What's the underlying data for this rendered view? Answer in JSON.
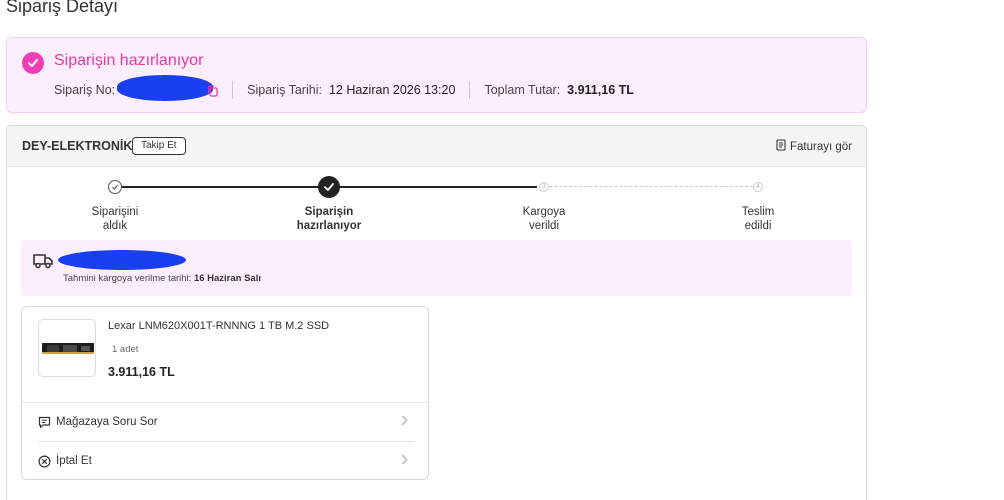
{
  "page": {
    "title": "Sipariş Detayı"
  },
  "status": {
    "title": "Siparişin hazırlanıyor",
    "order_no_label": "Sipariş No:",
    "order_date_label": "Sipariş Tarihi:",
    "order_date_value": "12 Haziran 2026 13:20",
    "total_label": "Toplam Tutar:",
    "total_value": "3.911,16 TL",
    "accent_color": "#e8379f"
  },
  "seller": {
    "name": "DEY-ELEKTRONİK",
    "follow_label": "Takip Et",
    "invoice_label": "Faturayı gör"
  },
  "stepper": {
    "steps": [
      {
        "line1": "Siparişini",
        "line2": "aldık",
        "state": "done"
      },
      {
        "line1": "Siparişin",
        "line2": "hazırlanıyor",
        "state": "current"
      },
      {
        "line1": "Kargoya",
        "line2": "verildi",
        "state": "pending",
        "number": "3"
      },
      {
        "line1": "Teslim",
        "line2": "edildi",
        "state": "pending",
        "number": "4"
      }
    ]
  },
  "shipping": {
    "estimate_label": "Tahmini kargoya verilme tarihi:",
    "estimate_value": "16 Haziran Salı"
  },
  "product": {
    "name": "Lexar LNM620X001T-RNNNG 1 TB M.2 SSD",
    "quantity": "1 adet",
    "price": "3.911,16 TL",
    "actions": [
      {
        "label": "Mağazaya Soru Sor",
        "icon": "message-question-icon"
      },
      {
        "label": "İptal Et",
        "icon": "cancel-circle-icon"
      }
    ]
  }
}
